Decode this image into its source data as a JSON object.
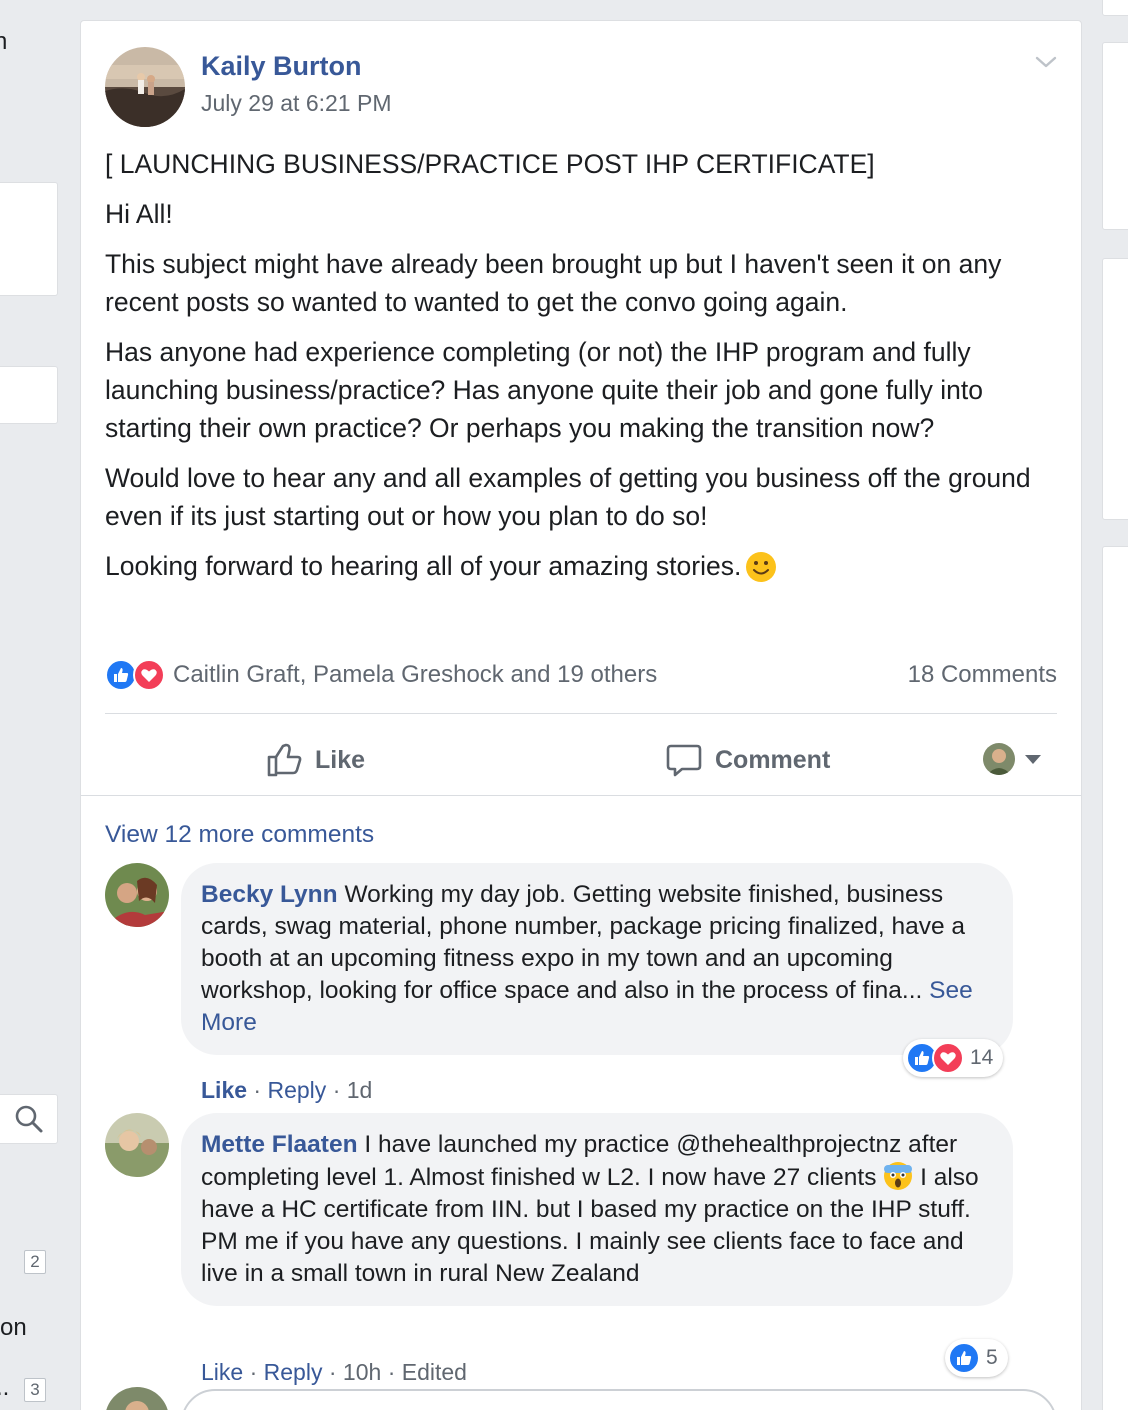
{
  "left_strip": {
    "text_fragments": [
      "n",
      "on",
      ".."
    ],
    "badges": [
      "2",
      "3"
    ]
  },
  "post": {
    "author": "Kaily Burton",
    "time": "July 29 at 6:21 PM",
    "paragraphs": [
      "[ LAUNCHING BUSINESS/PRACTICE POST IHP CERTIFICATE]",
      "Hi All!",
      "This subject might have already been brought up but I haven't seen it on any recent posts so wanted to wanted to get the convo going again.",
      "Has anyone had experience completing (or not) the IHP program and fully launching business/practice? Has anyone quite their job and gone fully into starting their own practice? Or perhaps you making the transition now?",
      "Would love to hear any and all examples of getting you business off the ground even if its just starting out or how you plan to do so!",
      "Looking forward to hearing all of your amazing stories."
    ],
    "reactions_text": "Caitlin Graft, Pamela Greshock and 19 others",
    "comments_count": "18 Comments",
    "actions": {
      "like": "Like",
      "comment": "Comment"
    }
  },
  "comments_section": {
    "view_more": "View 12 more comments",
    "comments": [
      {
        "author": "Becky Lynn",
        "text": "Working my day job. Getting website finished, business cards, swag material, phone number, package pricing finalized, have a booth at an upcoming fitness expo in my town and an upcoming workshop, looking for office space and also in the process of fina...",
        "see_more": "See More",
        "reaction_count": "14",
        "meta": {
          "like": "Like",
          "reply": "Reply",
          "time": "1d"
        }
      },
      {
        "author": "Mette Flaaten",
        "text_before_emoji": "I have launched my practice @thehealthprojectnz after completing level 1. Almost finished w L2. I now have 27 clients",
        "text_after_emoji": "I also have a HC certificate from IIN. but I based my practice on the IHP stuff. PM me if you have any questions. I mainly see clients face to face and live in a small town in rural New Zealand",
        "reaction_count": "5",
        "meta": {
          "like": "Like",
          "reply": "Reply",
          "time": "10h",
          "edited": "Edited"
        }
      }
    ]
  },
  "colors": {
    "link": "#385898",
    "secondary_text": "#606770",
    "like_blue": "#2078f4",
    "love_red": "#f33e58",
    "bubble_bg": "#f2f3f5"
  },
  "icons": [
    "chevron-down-icon",
    "like-reaction-icon",
    "love-reaction-icon",
    "thumbs-up-icon",
    "comment-bubble-icon",
    "caret-down-icon",
    "search-icon",
    "smile-emoji-icon",
    "scream-emoji-icon"
  ]
}
